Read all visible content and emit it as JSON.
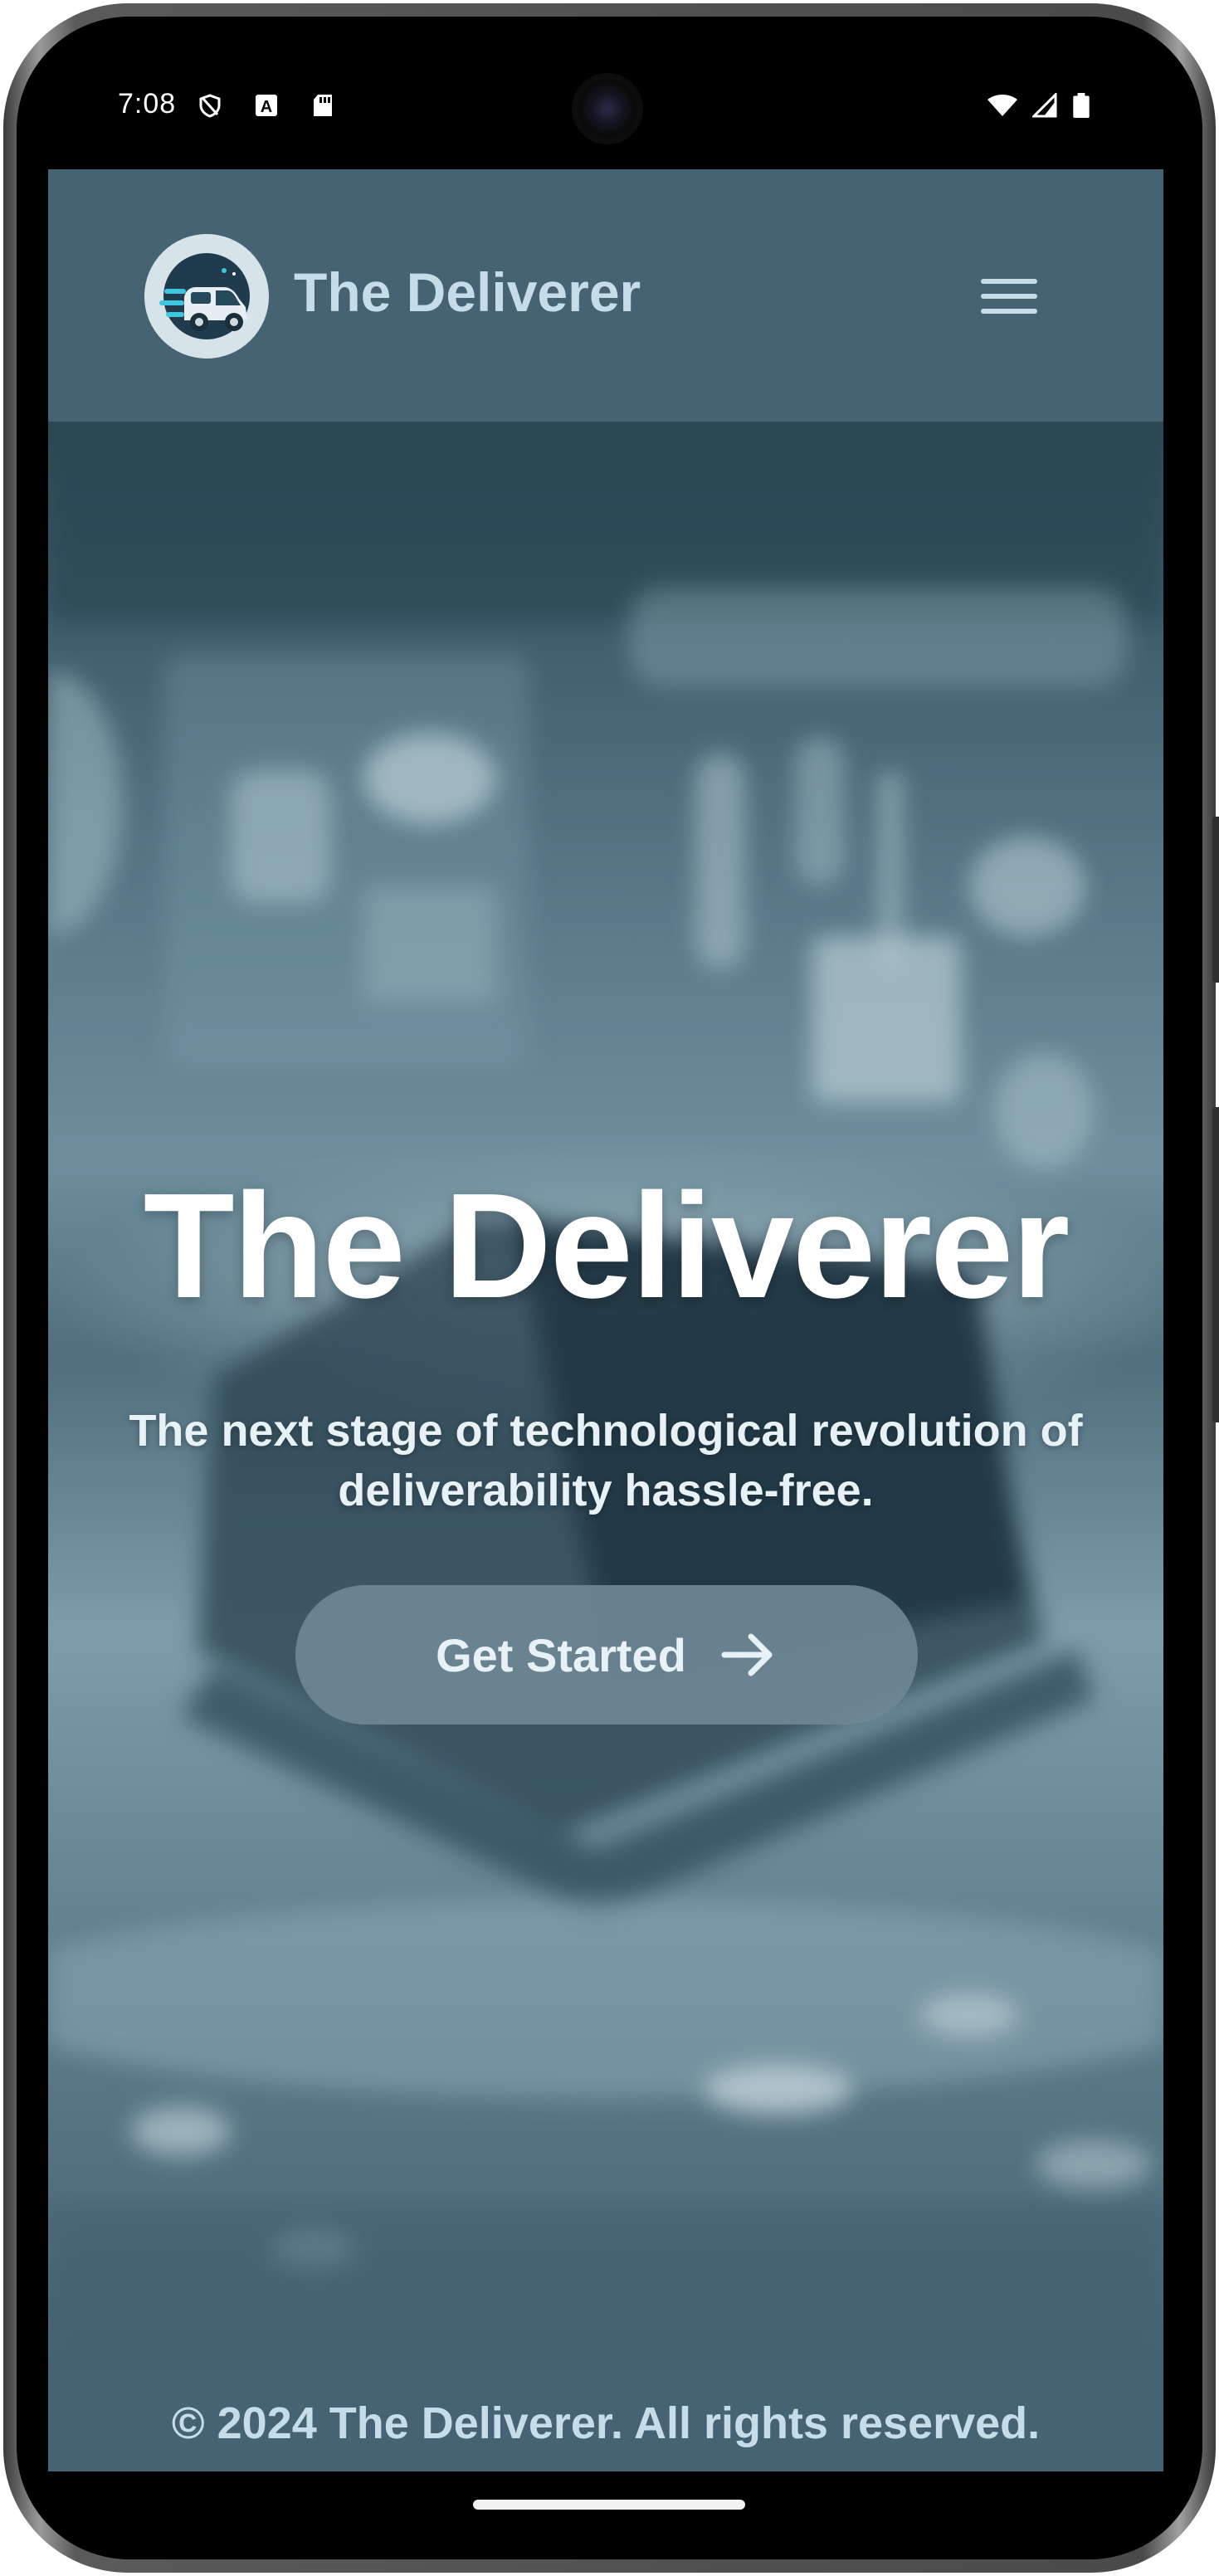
{
  "status_bar": {
    "time": "7:08",
    "left_icons": [
      "shield-icon",
      "a-badge-icon",
      "sd-card-icon"
    ],
    "right_icons": [
      "wifi-icon",
      "cellular-signal-icon",
      "battery-icon"
    ]
  },
  "header": {
    "brand_name": "The Deliverer",
    "logo_icon": "delivery-van-icon",
    "menu_icon": "hamburger-menu-icon"
  },
  "hero": {
    "title": "The Deliverer",
    "subtitle": "The next stage of technological revolution of deliverability hassle-free.",
    "cta_label": "Get Started",
    "cta_icon": "arrow-right-icon"
  },
  "footer": {
    "text": "© 2024 The Deliverer. All rights reserved."
  },
  "colors": {
    "header_bg": "#466373",
    "brand_text": "#c4dde8",
    "hero_title": "#ffffff",
    "cta_bg": "#6e8794"
  }
}
